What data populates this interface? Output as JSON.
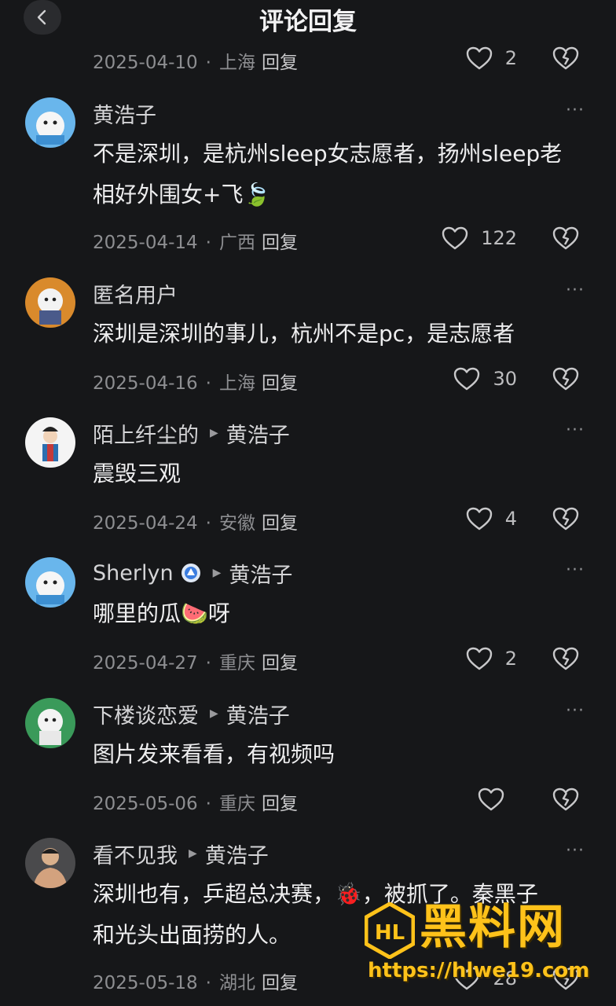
{
  "header": {
    "title": "评论回复"
  },
  "first_meta": {
    "date": "2025-04-10",
    "location": "上海",
    "reply": "回复",
    "likes": "2"
  },
  "comments": [
    {
      "username": "黄浩子",
      "reply_to": "",
      "text_lines": [
        "不是深圳，是杭州sleep女志愿者，扬州sleep老",
        "相好外围女+飞🍃"
      ],
      "date": "2025-04-14",
      "location": "广西",
      "reply": "回复",
      "likes": "122"
    },
    {
      "username": "匿名用户",
      "reply_to": "",
      "text_lines": [
        "深圳是深圳的事儿，杭州不是pc，是志愿者"
      ],
      "date": "2025-04-16",
      "location": "上海",
      "reply": "回复",
      "likes": "30"
    },
    {
      "username": "陌上纤尘的",
      "reply_to": "黄浩子",
      "text_lines": [
        "震毁三观"
      ],
      "date": "2025-04-24",
      "location": "安徽",
      "reply": "回复",
      "likes": "4"
    },
    {
      "username": "Sherlyn",
      "reply_to": "黄浩子",
      "text_lines": [
        "哪里的瓜🍉呀"
      ],
      "date": "2025-04-27",
      "location": "重庆",
      "reply": "回复",
      "likes": "2"
    },
    {
      "username": "下楼谈恋爱",
      "reply_to": "黄浩子",
      "text_lines": [
        "图片发来看看，有视频吗"
      ],
      "date": "2025-05-06",
      "location": "重庆",
      "reply": "回复",
      "likes": ""
    },
    {
      "username": "看不见我",
      "reply_to": "黄浩子",
      "text_lines": [
        "深圳也有，乒超总决赛，🐞，被抓了。秦黑子",
        "和光头出面捞的人。"
      ],
      "date": "2025-05-18",
      "location": "湖北",
      "reply": "回复",
      "likes": "28"
    }
  ],
  "watermark": {
    "brand": "黑料网",
    "logo": "HL",
    "url": "https://hlwe19.com"
  },
  "colors": {
    "background": "#161719",
    "text": "#eeeeef",
    "muted": "#8d8e91",
    "watermark": "#ffc21a"
  }
}
